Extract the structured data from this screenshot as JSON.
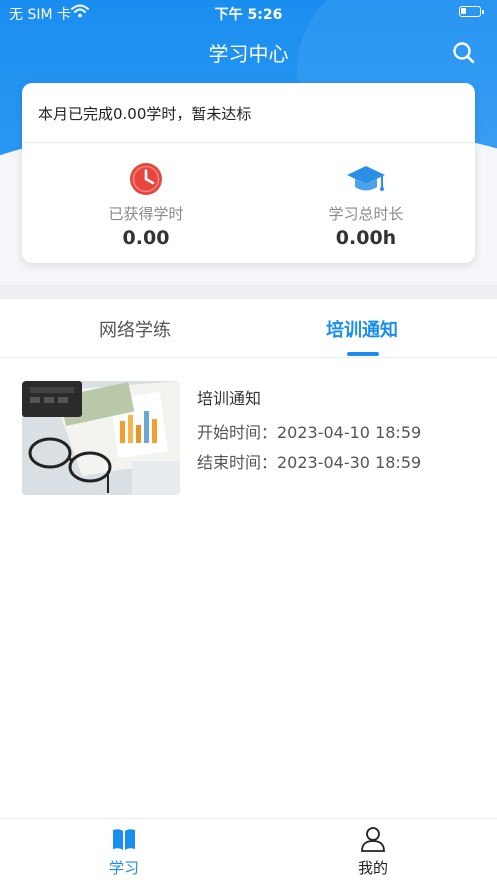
{
  "status_bar": {
    "carrier": "无 SIM 卡",
    "time": "下午 5:26"
  },
  "header": {
    "title": "学习中心"
  },
  "summary": {
    "progress_text": "本月已完成0.00学时，暂未达标",
    "earned": {
      "label": "已获得学时",
      "value": "0.00",
      "icon": "clock-icon"
    },
    "total": {
      "label": "学习总时长",
      "value": "0.00h",
      "icon": "graduation-cap-icon"
    }
  },
  "tabs": [
    {
      "label": "网络学练",
      "active": false
    },
    {
      "label": "培训通知",
      "active": true
    }
  ],
  "notices": [
    {
      "title": "培训通知",
      "start": "开始时间：2023-04-10 18:59",
      "end": "结束时间：2023-04-30 18:59"
    }
  ],
  "tabbar": [
    {
      "label": "学习",
      "icon": "book-icon",
      "active": true
    },
    {
      "label": "我的",
      "icon": "user-icon",
      "active": false
    }
  ],
  "colors": {
    "accent": "#1a8ef0",
    "clock_red": "#e8463c",
    "cap_blue": "#2b8fe6"
  }
}
